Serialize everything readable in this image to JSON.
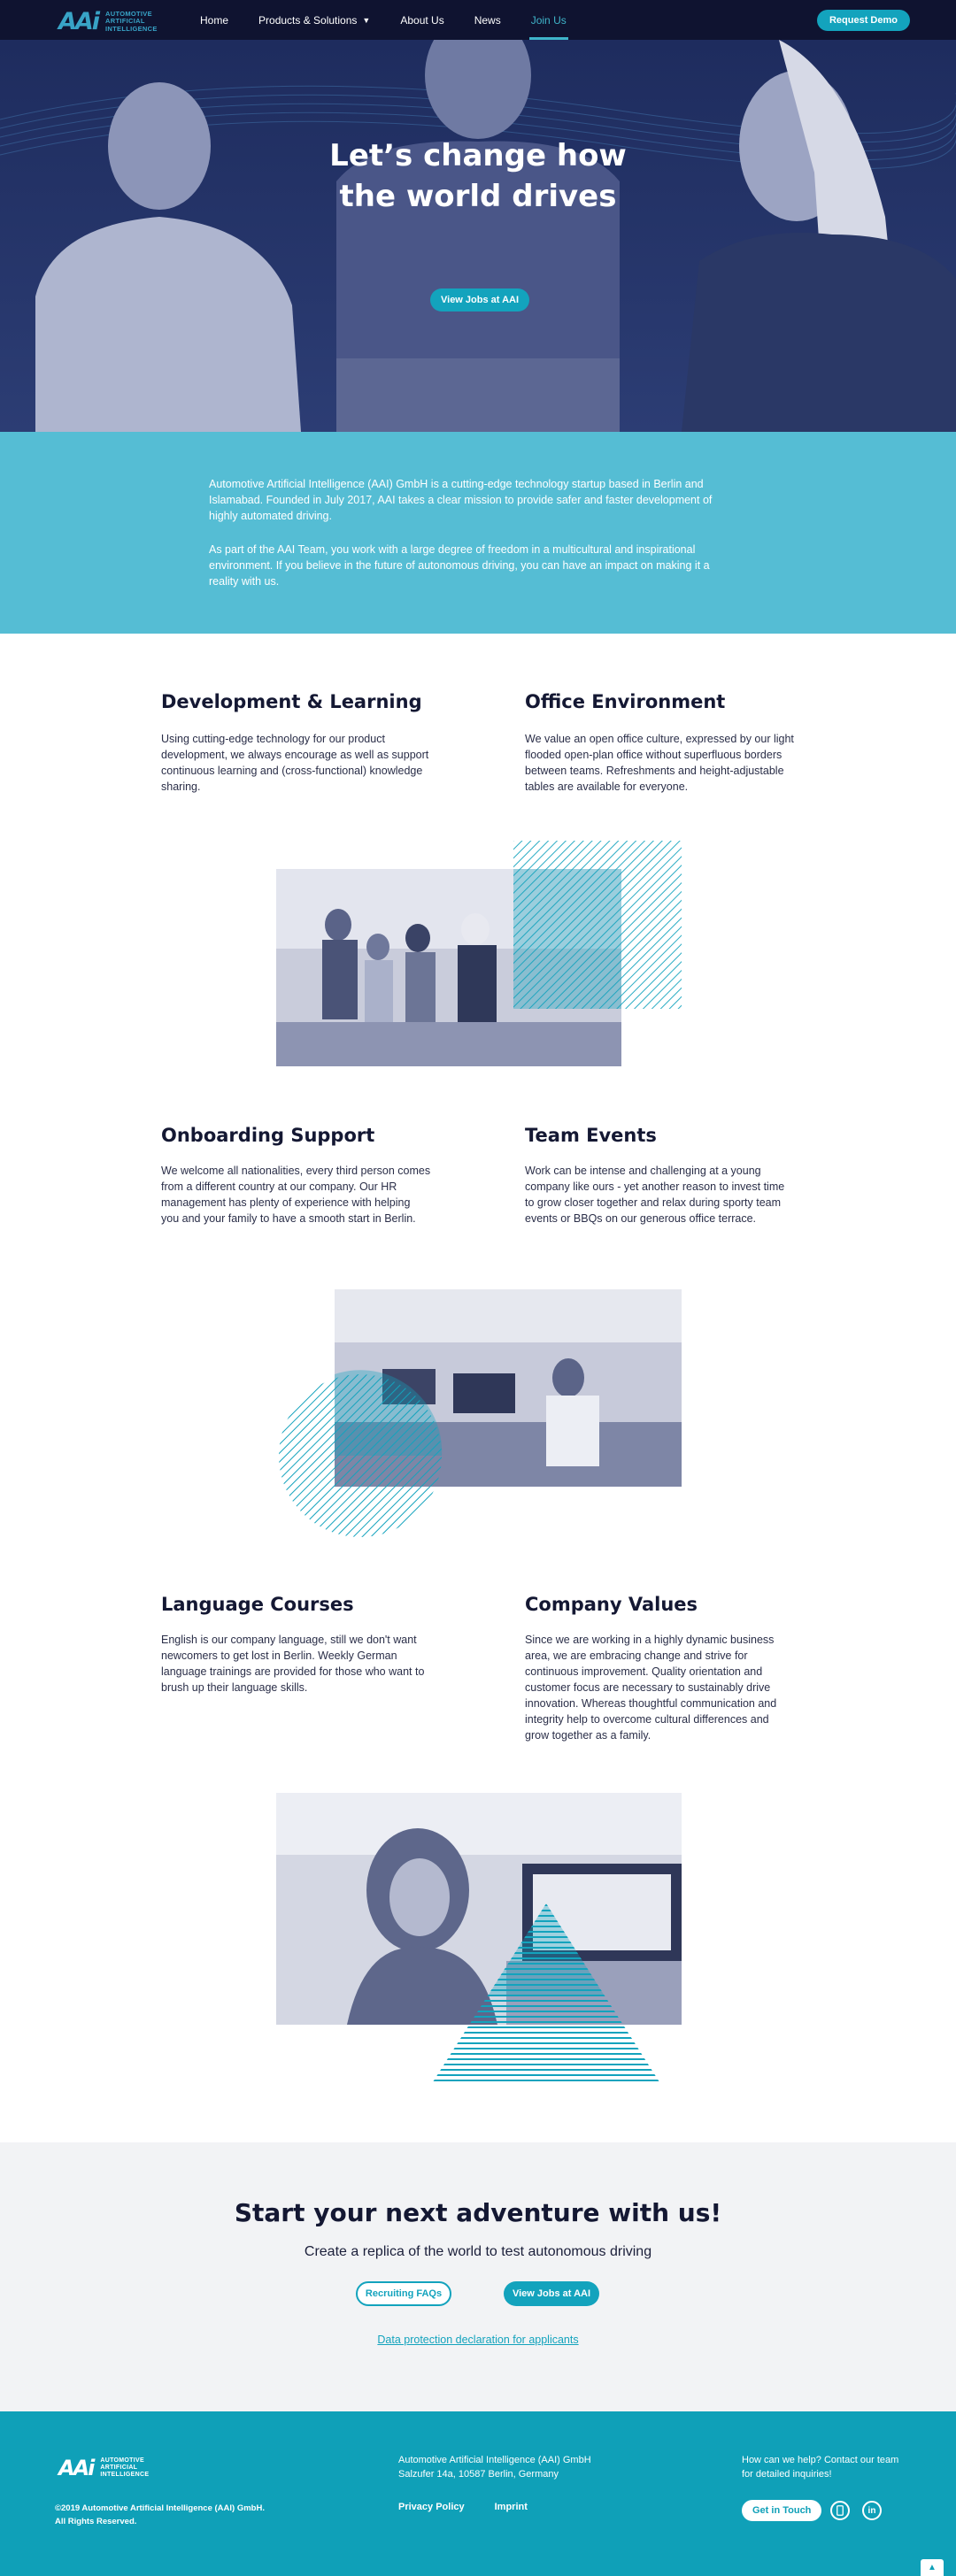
{
  "nav": {
    "logo_mark": "AAi",
    "logo_lines": [
      "AUTOMOTIVE",
      "ARTIFICIAL",
      "INTELLIGENCE"
    ],
    "links": [
      {
        "label": "Home"
      },
      {
        "label": "Products & Solutions"
      },
      {
        "label": "About Us"
      },
      {
        "label": "News"
      },
      {
        "label": "Join Us"
      }
    ],
    "cta": "Request Demo"
  },
  "hero": {
    "title": "Let’s change how the world drives",
    "button": "View Jobs at AAI"
  },
  "intro": {
    "p1": "Automotive Artificial Intelligence (AAI) GmbH is a cutting-edge technology startup based in Berlin and Islamabad. Founded in July 2017, AAI takes a clear mission to provide safer and faster development of highly automated driving.",
    "p2": "As part of the AAI Team, you work with a large degree of freedom in a multicultural and inspirational environment. If you believe in the future of autonomous driving, you can have an impact on making it a reality with us."
  },
  "features": [
    {
      "title": "Development & Learning",
      "text": "Using cutting-edge technology for our product development, we always encourage as well as support continuous learning and (cross-functional) knowledge sharing."
    },
    {
      "title": "Office Environment",
      "text": "We value an open office culture, expressed by our light flooded open-plan office without superfluous borders between teams. Refreshments and height-adjustable tables are available for everyone."
    },
    {
      "title": "Onboarding Support",
      "text": "We welcome all nationalities, every third person comes from a different country at our company. Our HR management has plenty of experience with helping you and your family to have a smooth start in Berlin."
    },
    {
      "title": "Team Events",
      "text": "Work can be intense and challenging at a young company like ours - yet another reason to invest time to grow closer together and relax during sporty team events or BBQs on our generous office terrace."
    },
    {
      "title": "Language Courses",
      "text": "English is our company language, still we don't want newcomers to get lost in Berlin. Weekly German language trainings are provided for those who want to brush up their language skills."
    },
    {
      "title": "Company Values",
      "text": "Since we are working in a highly dynamic business area, we are embracing change and strive for continuous improvement. Quality orientation and customer focus are necessary to sustainably drive innovation. Whereas thoughtful communication and integrity help to overcome cultural differences and grow together as a family."
    }
  ],
  "cta": {
    "title": "Start your next adventure with us!",
    "subtitle": "Create a replica of the world to test autonomous driving",
    "faq_button": "Recruiting FAQs",
    "jobs_button": "View Jobs at AAI",
    "link": "Data protection declaration for applicants"
  },
  "footer": {
    "copyright_1": "©2019 Automotive Artificial Intelligence (AAI) GmbH.",
    "copyright_2": "All Rights Reserved.",
    "address_1": "Automotive Artificial Intelligence (AAI) GmbH",
    "address_2": "Salzufer 14a, 10587 Berlin, Germany",
    "privacy": "Privacy Policy",
    "imprint": "Imprint",
    "help_text": "How can we help? Contact our team for detailed inquiries!",
    "contact_button": "Get in Touch",
    "icons": [
      "mobile-icon",
      "linkedin-icon"
    ],
    "linkedin_glyph": "in"
  },
  "colors": {
    "nav_bg": "#0f1330",
    "accent": "#13a3bd",
    "intro_bg": "#55bdd4",
    "cta_bg": "#f2f3f5",
    "footer_bg": "#0fa0b8"
  }
}
